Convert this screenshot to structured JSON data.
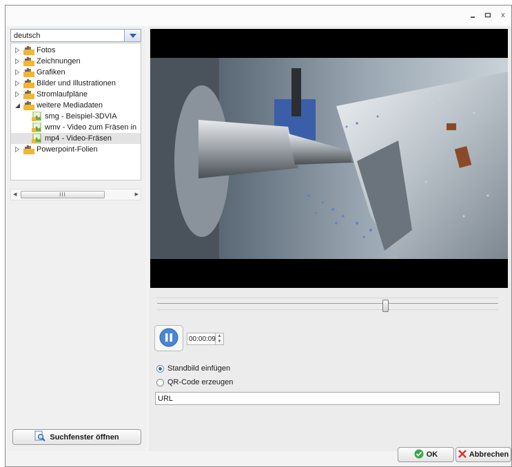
{
  "window": {
    "minimize_icon": "minimize-icon",
    "maximize_icon": "maximize-icon",
    "close_label": "x"
  },
  "language": {
    "selected": "deutsch"
  },
  "tree": {
    "items": [
      {
        "label": "Fotos",
        "level": 0,
        "expander": "collapsed"
      },
      {
        "label": "Zeichnungen",
        "level": 0,
        "expander": "collapsed"
      },
      {
        "label": "Grafiken",
        "level": 0,
        "expander": "collapsed"
      },
      {
        "label": "Bilder und Illustrationen",
        "level": 0,
        "expander": "collapsed"
      },
      {
        "label": "Stromlaufpläne",
        "level": 0,
        "expander": "collapsed"
      },
      {
        "label": "weitere Mediadaten",
        "level": 0,
        "expander": "expanded"
      },
      {
        "label": "smg - Beispiel-3DVIA",
        "level": 1,
        "expander": "none"
      },
      {
        "label": "wmv - Video zum Fräsen in",
        "level": 1,
        "expander": "none"
      },
      {
        "label": "mp4 - Video-Fräsen",
        "level": 1,
        "expander": "none",
        "selected": true
      },
      {
        "label": "Powerpoint-Folien",
        "level": 0,
        "expander": "collapsed"
      }
    ],
    "scroll_thumb_label": "III"
  },
  "search_button": {
    "label": "Suchfenster öffnen"
  },
  "player": {
    "time": "00:00:09",
    "position_fraction": 0.67,
    "state": "playing"
  },
  "options": {
    "still_image": {
      "label": "Standbild einfügen",
      "checked": true
    },
    "qr_code": {
      "label": "QR-Code erzeugen",
      "checked": false
    },
    "url_value": "URL"
  },
  "footer": {
    "ok_label": "OK",
    "cancel_label": "Abbrechen"
  },
  "colors": {
    "accent": "#3b6fb6",
    "ok_green": "#3aa64a",
    "cancel_red": "#d9352b",
    "folder_yellow": "#f2b632"
  }
}
